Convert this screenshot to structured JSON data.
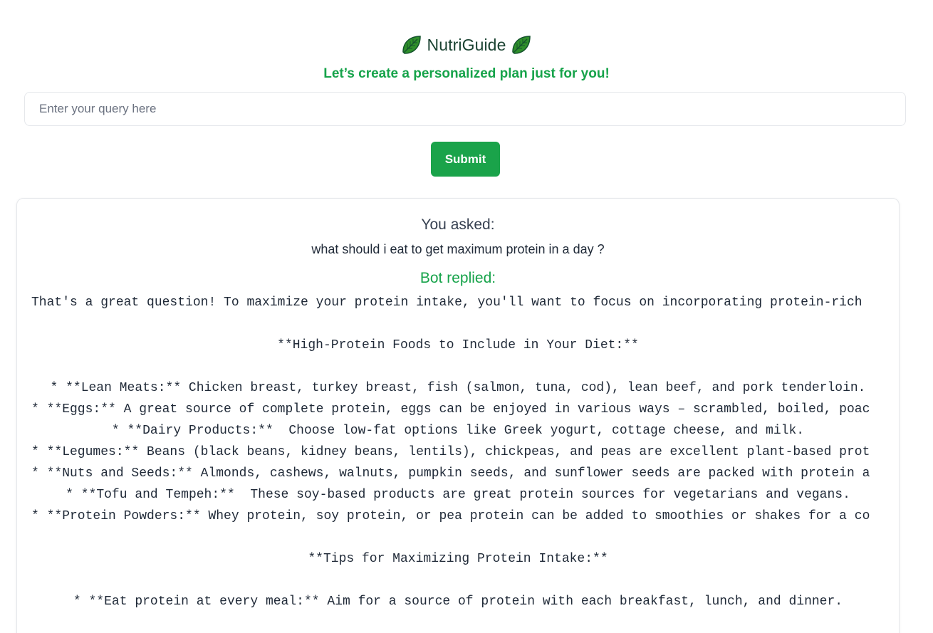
{
  "app": {
    "title": "NutriGuide",
    "subtitle": "Let’s create a personalized plan just for you!",
    "leaf_icon": "leaf-icon",
    "accent_color": "#16a34a"
  },
  "search": {
    "placeholder": "Enter your query here",
    "value": ""
  },
  "submit": {
    "label": "Submit"
  },
  "conversation": {
    "asked_label": "You asked:",
    "question": "what should i eat to get maximum protein in a day ?",
    "reply_label": "Bot replied:",
    "reply_lines": [
      "That's a great question! To maximize your protein intake, you'll want to focus on incorporating protein-rich",
      "",
      "**High-Protein Foods to Include in Your Diet:**",
      "",
      "* **Lean Meats:** Chicken breast, turkey breast, fish (salmon, tuna, cod), lean beef, and pork tenderloin.",
      "* **Eggs:** A great source of complete protein, eggs can be enjoyed in various ways – scrambled, boiled, poac",
      "* **Dairy Products:**  Choose low-fat options like Greek yogurt, cottage cheese, and milk.",
      "* **Legumes:** Beans (black beans, kidney beans, lentils), chickpeas, and peas are excellent plant-based prot",
      "* **Nuts and Seeds:** Almonds, cashews, walnuts, pumpkin seeds, and sunflower seeds are packed with protein a",
      "* **Tofu and Tempeh:**  These soy-based products are great protein sources for vegetarians and vegans.",
      "* **Protein Powders:** Whey protein, soy protein, or pea protein can be added to smoothies or shakes for a co",
      "",
      "**Tips for Maximizing Protein Intake:**",
      "",
      "* **Eat protein at every meal:** Aim for a source of protein with each breakfast, lunch, and dinner."
    ]
  }
}
